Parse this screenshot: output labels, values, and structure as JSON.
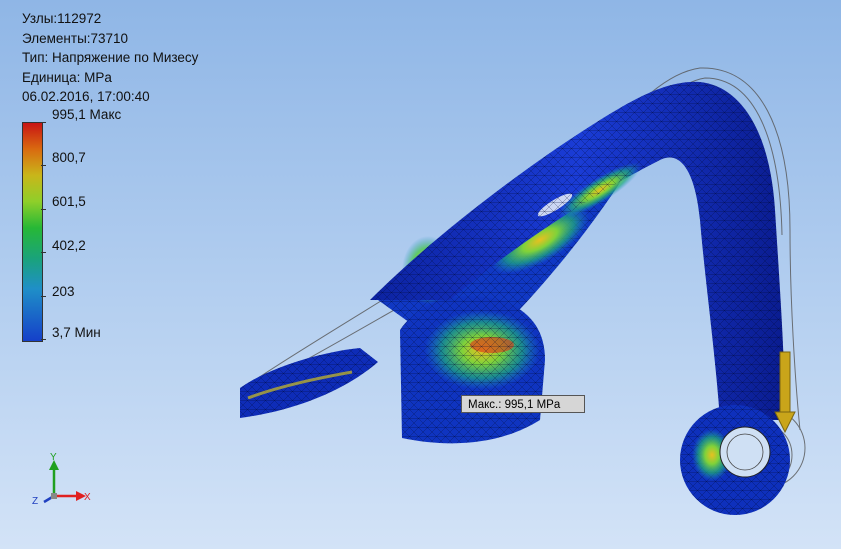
{
  "info": {
    "nodes": "Узлы:112972",
    "elements": "Элементы:73710",
    "type": "Тип: Напряжение по Мизесу",
    "unit": "Единица: MPa",
    "timestamp": "06.02.2016, 17:00:40"
  },
  "legend": {
    "labels": [
      "995,1 Макс",
      "800,7",
      "601,5",
      "402,2",
      "203",
      "3,7 Мин"
    ],
    "colors": [
      "#c81414",
      "#d96a10",
      "#c9b61a",
      "#8fcf2a",
      "#27b836",
      "#1aa37a",
      "#1f8fc8",
      "#1540c9"
    ]
  },
  "probe": {
    "label": "Макс.: 995,1 MPa"
  },
  "triad": {
    "x": "X",
    "y": "Y",
    "z": "Z"
  },
  "colors": {
    "mesh_base": "#0a28b0",
    "x_axis": "#e02020",
    "y_axis": "#20a020",
    "z_axis": "#2040c0"
  }
}
